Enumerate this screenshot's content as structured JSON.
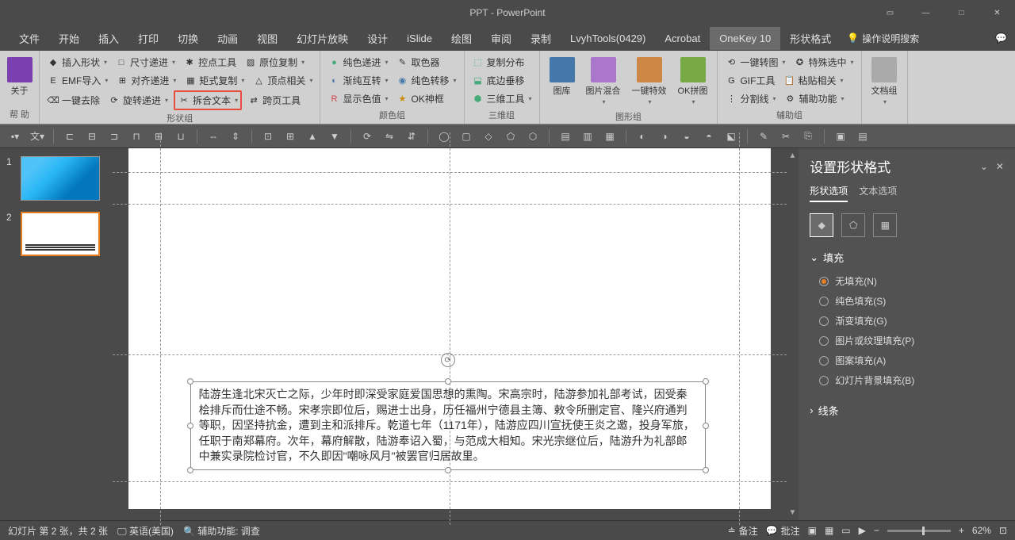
{
  "title": "PPT - PowerPoint",
  "menu": [
    "文件",
    "开始",
    "插入",
    "打印",
    "切换",
    "动画",
    "视图",
    "幻灯片放映",
    "设计",
    "iSlide",
    "绘图",
    "审阅",
    "录制",
    "LvyhTools(0429)",
    "Acrobat",
    "OneKey 10",
    "形状格式"
  ],
  "menu_active": "OneKey 10",
  "tell_me": "操作说明搜索",
  "ribbon": {
    "g0": {
      "label": "帮 助",
      "about": "关于"
    },
    "g1": {
      "label": "形状组",
      "r1": [
        "插入形状",
        "尺寸递进",
        "控点工具",
        "原位复制"
      ],
      "r2": [
        "EMF导入",
        "对齐递进",
        "矩式复制",
        "顶点相关"
      ],
      "r3": [
        "一键去除",
        "旋转递进",
        "拆合文本",
        "跨页工具"
      ]
    },
    "g2": {
      "label": "颜色组",
      "r1": [
        "纯色递进",
        "取色器"
      ],
      "r2": [
        "渐纯互转",
        "纯色转移"
      ],
      "r3": [
        "显示色值",
        "OK神框"
      ]
    },
    "g3": {
      "label": "三维组",
      "r1": "复制分布",
      "r2": "底边垂移",
      "r3": "三维工具"
    },
    "g4": {
      "label": "图形组",
      "b1": "图库",
      "b2": "图片混合",
      "b3": "一键特效",
      "b4": "OK拼图"
    },
    "g5": {
      "label": "辅助组",
      "r1": [
        "一键转图",
        "特殊选中"
      ],
      "r2": [
        "GIF工具",
        "粘贴相关"
      ],
      "r3": [
        "分割线",
        "辅助功能"
      ]
    },
    "g6": {
      "b1": "文档组"
    }
  },
  "slide_text": "陆游生逢北宋灭亡之际，少年时即深受家庭爱国思想的熏陶。宋高宗时，陆游参加礼部考试，因受秦桧排斥而仕途不畅。宋孝宗即位后，赐进士出身，历任福州宁德县主簿、敕令所删定官、隆兴府通判等职，因坚持抗金，遭到主和派排斥。乾道七年（1171年），陆游应四川宣抚使王炎之邀，投身军旅，任职于南郑幕府。次年，幕府解散，陆游奉诏入蜀，与范成大相知。宋光宗继位后，陆游升为礼部郎中兼实录院检讨官，不久即因\"嘲咏风月\"被罢官归居故里。",
  "format_pane": {
    "title": "设置形状格式",
    "tabs": [
      "形状选项",
      "文本选项"
    ],
    "fill_header": "填充",
    "fill_options": [
      {
        "label": "无填充(N)",
        "checked": true
      },
      {
        "label": "纯色填充(S)",
        "checked": false
      },
      {
        "label": "渐变填充(G)",
        "checked": false
      },
      {
        "label": "图片或纹理填充(P)",
        "checked": false
      },
      {
        "label": "图案填充(A)",
        "checked": false
      },
      {
        "label": "幻灯片背景填充(B)",
        "checked": false
      }
    ],
    "line_header": "线条"
  },
  "statusbar": {
    "slide_info": "幻灯片 第 2 张，共 2 张",
    "lang": "英语(美国)",
    "access": "辅助功能: 调查",
    "notes": "备注",
    "comments": "批注",
    "zoom": "62%"
  },
  "thumbs": {
    "n1": "1",
    "n2": "2"
  }
}
